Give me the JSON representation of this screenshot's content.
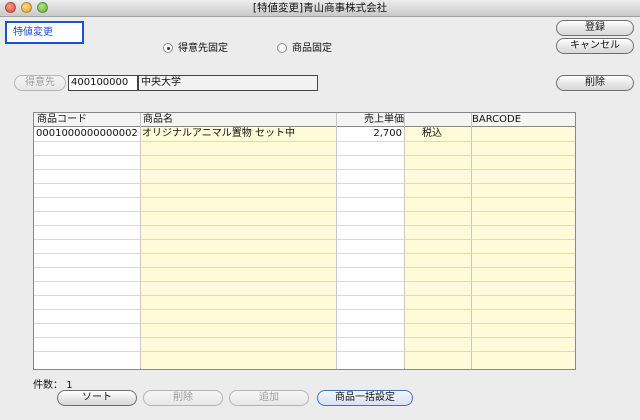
{
  "window": {
    "title": "[特値変更]青山商事株式会社"
  },
  "mode": {
    "label": "特値変更"
  },
  "buttons": {
    "register": "登録",
    "cancel": "キャンセル",
    "delete_top": "削除",
    "customer": "得意先",
    "sort": "ソート",
    "delete_bottom": "削除",
    "add": "追加",
    "bulk_set": "商品一括設定"
  },
  "radios": {
    "customer_fixed": "得意先固定",
    "product_fixed": "商品固定"
  },
  "customer": {
    "code": "400100000",
    "name": "中央大学"
  },
  "table": {
    "headers": [
      "商品コード",
      "商品名",
      "売上単価",
      "",
      "BARCODE"
    ],
    "rows": [
      {
        "code": "0001000000000002",
        "name": "オリジナルアニマル置物 セット中",
        "price": "2,700",
        "tax": "税込",
        "barcode": ""
      }
    ]
  },
  "footer": {
    "count_label": "件数：",
    "count": "1"
  },
  "colors": {
    "accent": "#1f4fd6",
    "column_yellow": "#fffbd9"
  }
}
